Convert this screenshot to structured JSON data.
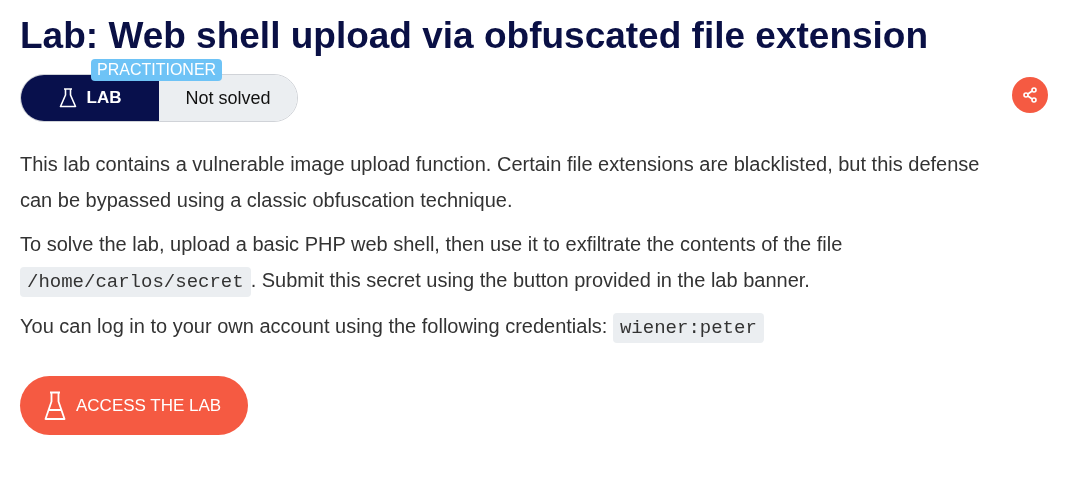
{
  "title": "Lab: Web shell upload via obfuscated file extension",
  "badge": {
    "level": "PRACTITIONER",
    "type": "LAB",
    "status": "Not solved"
  },
  "paragraphs": [
    [
      {
        "kind": "text",
        "text": "This lab contains a vulnerable image upload function. Certain file extensions are blacklisted, but this defense can be bypassed using a classic obfuscation technique."
      }
    ],
    [
      {
        "kind": "text",
        "text": "To solve the lab, upload a basic PHP web shell, then use it to exfiltrate the contents of the file "
      },
      {
        "kind": "code",
        "text": "/home/carlos/secret"
      },
      {
        "kind": "text",
        "text": ". Submit this secret using the button provided in the lab banner."
      }
    ],
    [
      {
        "kind": "text",
        "text": "You can log in to your own account using the following credentials: "
      },
      {
        "kind": "code",
        "text": "wiener:peter"
      }
    ]
  ],
  "button": "ACCESS THE LAB"
}
